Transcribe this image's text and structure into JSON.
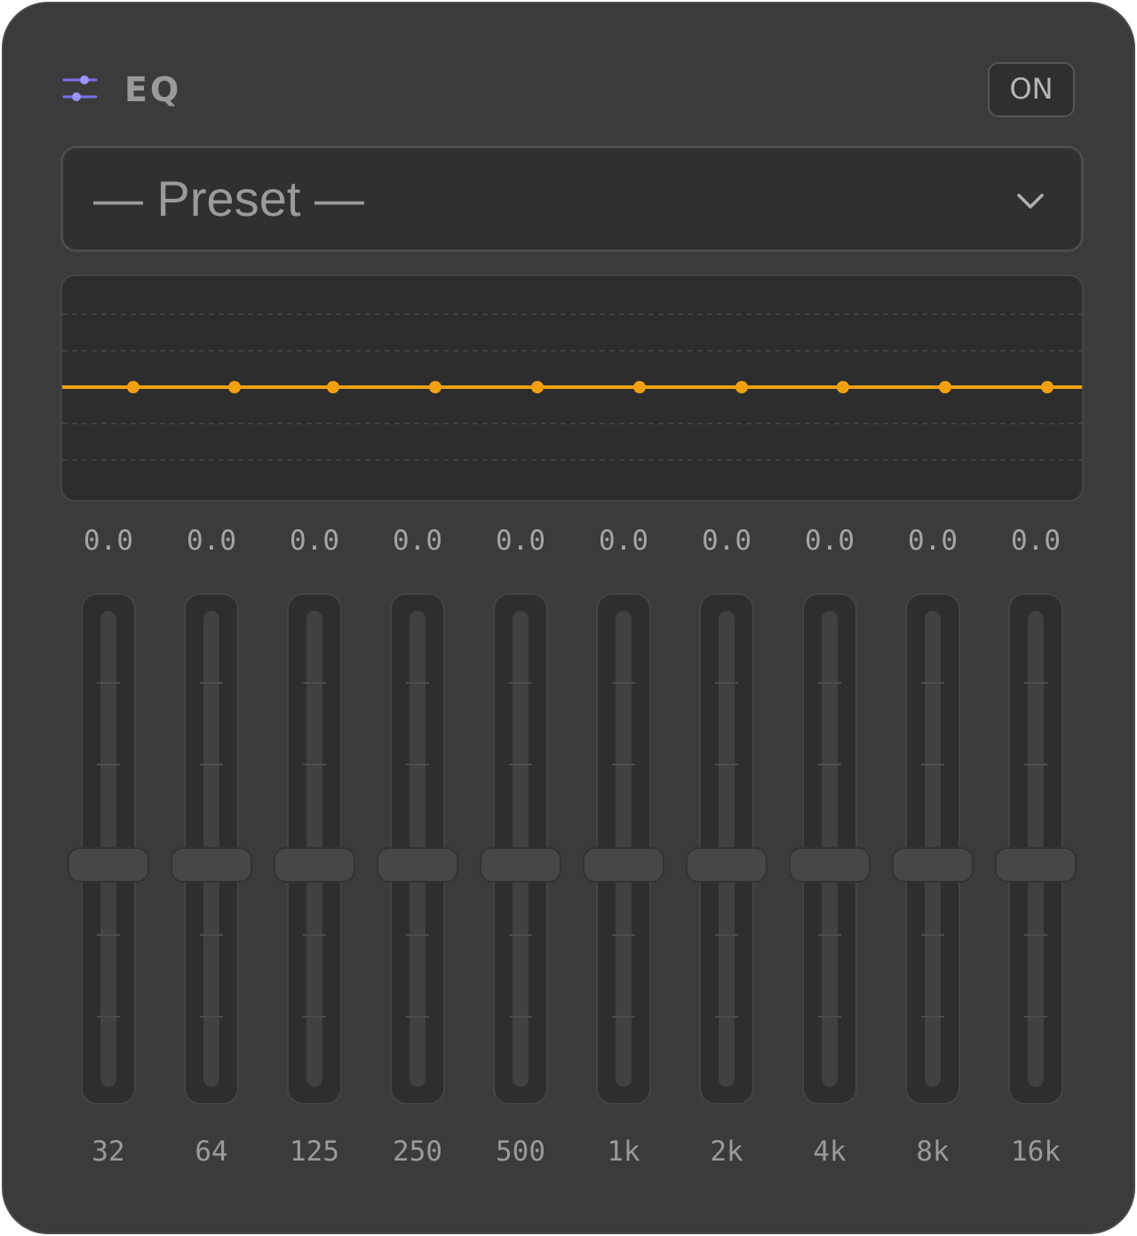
{
  "header": {
    "title": "EQ",
    "icon": "sliders-icon",
    "power_label": "ON"
  },
  "preset": {
    "label": "— Preset —",
    "icon": "chevron-down-icon"
  },
  "colors": {
    "accent": "#7c6ff0",
    "curve": "#f0a010",
    "panel": "#3b3b3b"
  },
  "gain_range_db": [
    -12,
    12
  ],
  "bands": [
    {
      "label": "32",
      "value_text": "0.0",
      "gain": 0
    },
    {
      "label": "64",
      "value_text": "0.0",
      "gain": 0
    },
    {
      "label": "125",
      "value_text": "0.0",
      "gain": 0
    },
    {
      "label": "250",
      "value_text": "0.0",
      "gain": 0
    },
    {
      "label": "500",
      "value_text": "0.0",
      "gain": 0
    },
    {
      "label": "1k",
      "value_text": "0.0",
      "gain": 0
    },
    {
      "label": "2k",
      "value_text": "0.0",
      "gain": 0
    },
    {
      "label": "4k",
      "value_text": "0.0",
      "gain": 0
    },
    {
      "label": "8k",
      "value_text": "0.0",
      "gain": 0
    },
    {
      "label": "16k",
      "value_text": "0.0",
      "gain": 0
    }
  ]
}
